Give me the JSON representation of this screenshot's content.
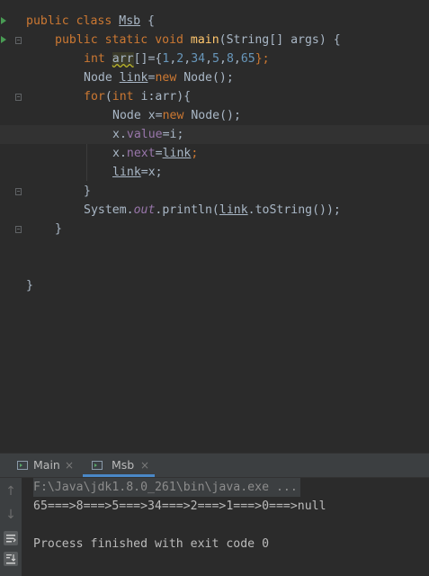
{
  "editor": {
    "line1": {
      "kw_public": "public",
      "kw_class": "class",
      "class_name": "Msb",
      "brace": " {"
    },
    "line2": {
      "kw_public": "public",
      "kw_static": "static",
      "kw_void": "void",
      "method": "main",
      "params": "(String[] args) {"
    },
    "line3": {
      "kw_int": "int",
      "var": "arr",
      "rest_open": "[]={",
      "n1": "1",
      "n2": "2",
      "n3": "34",
      "n4": "5",
      "n5": "8",
      "n6": "65",
      "close": "};"
    },
    "line4": {
      "type": "Node",
      "var": "link",
      "eq": "=",
      "kw_new": "new",
      "ctor": " Node();"
    },
    "line5": {
      "kw_for": "for",
      "open": "(",
      "kw_int": "int",
      "rest": " i:arr){"
    },
    "line6": {
      "type_var": "Node x=",
      "kw_new": "new",
      "ctor": " Node();"
    },
    "line7": {
      "obj": "x.",
      "field": "value",
      "rest": "=i;"
    },
    "line8": {
      "obj": "x.",
      "field": "next",
      "eq": "=",
      "var": "link",
      "semi": ";"
    },
    "line9": {
      "var": "link",
      "rest": "=x;"
    },
    "line10": {
      "brace": "}"
    },
    "line11": {
      "cls": "System.",
      "static_field": "out",
      "call": ".println(",
      "var": "link",
      "rest": ".toString());"
    },
    "line12": {
      "brace": "}"
    },
    "line15": {
      "brace": "}"
    }
  },
  "tabs": [
    {
      "label": "Main",
      "close": "×",
      "active": false
    },
    {
      "label": "Msb",
      "close": "×",
      "active": true
    }
  ],
  "console": {
    "command": "F:\\Java\\jdk1.8.0_261\\bin\\java.exe ...",
    "output": "65===>8===>5===>34===>2===>1===>0===>null",
    "exit": "Process finished with exit code 0"
  },
  "toolbar": {
    "up_icon": "up-arrow-icon",
    "down_icon": "down-arrow-icon",
    "soft_wrap_icon": "soft-wrap-icon",
    "scroll_end_icon": "scroll-to-end-icon"
  },
  "colors": {
    "keyword": "#cc7832",
    "number": "#6897bb",
    "method": "#ffc66d",
    "field": "#9876aa",
    "run_marker": "#499c54",
    "active_tab": "#4a88c7"
  }
}
